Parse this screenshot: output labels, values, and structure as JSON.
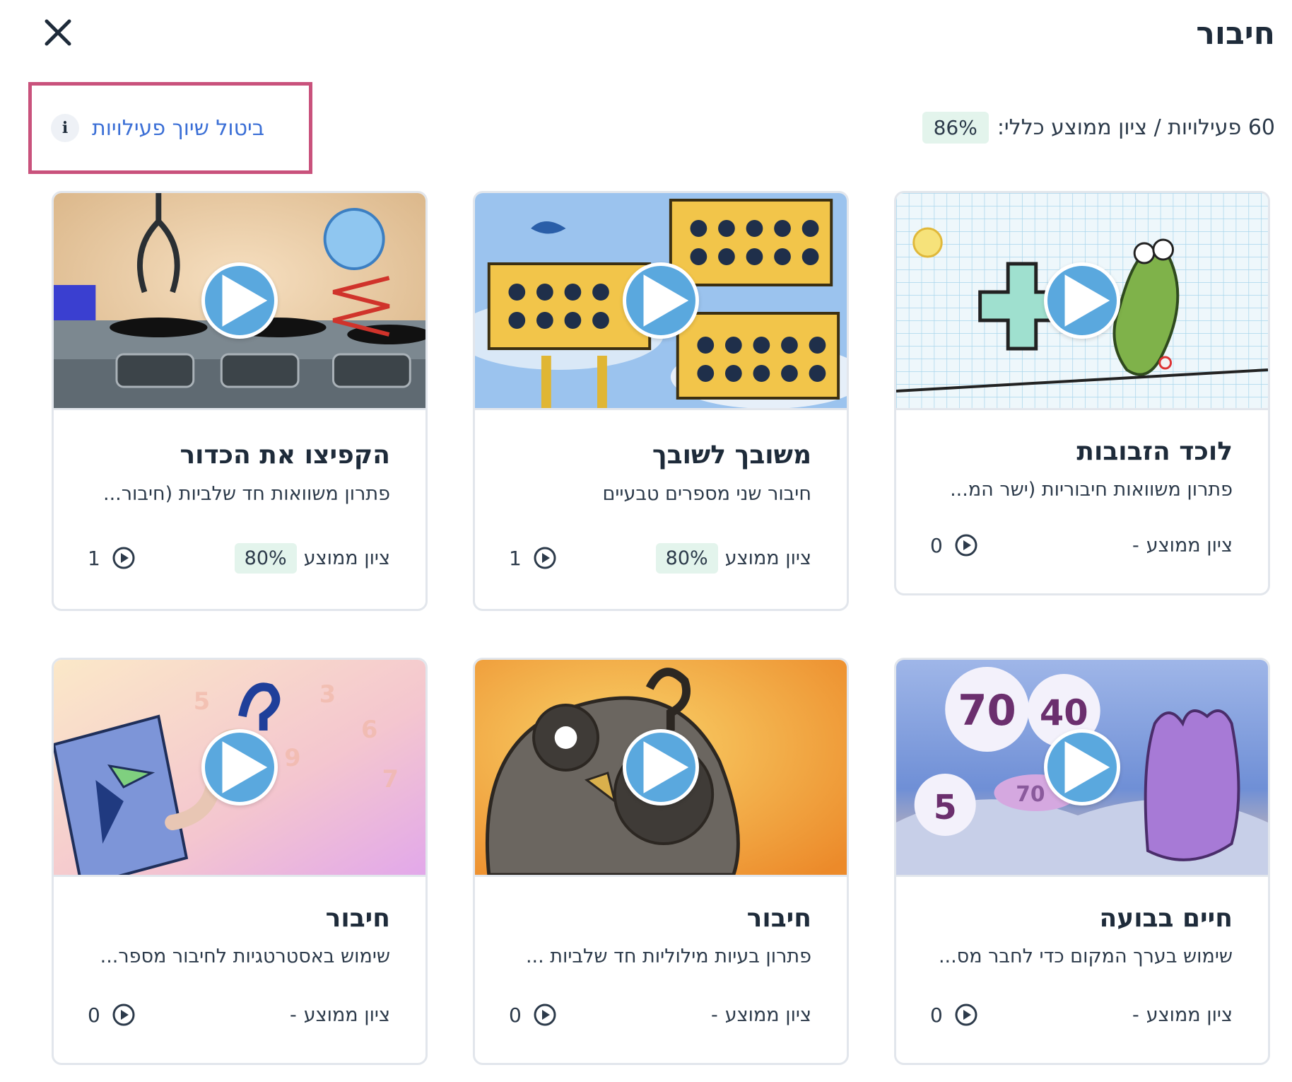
{
  "header": {
    "title": "חיבור",
    "close_icon": "close-icon"
  },
  "toolbar": {
    "unassign_label": "ביטול שיוך פעילויות",
    "info_icon_glyph": "i",
    "summary_text": "60 פעילויות / ציון ממוצע כללי:",
    "overall_average": "86%"
  },
  "cards": [
    {
      "title": "לוכד הזבובות",
      "description": "פתרון משוואות חיבוריות (ישר המ...",
      "avg_label": "ציון ממוצע",
      "avg_value": "-",
      "plays": "0",
      "image": "frog-number-line"
    },
    {
      "title": "משובך לשובך",
      "description": "חיבור שני מספרים טבעיים",
      "avg_label": "ציון ממוצע",
      "avg_value": "80%",
      "plays": "1",
      "image": "birdhouses"
    },
    {
      "title": "הקפיצו את הכדור",
      "description": "פתרון משוואות חד שלביות (חיבור...",
      "avg_label": "ציון ממוצע",
      "avg_value": "80%",
      "plays": "1",
      "image": "claw-bubble"
    },
    {
      "title": "חיים בבועה",
      "description": "שימוש בערך המקום כדי לחבר מס...",
      "avg_label": "ציון ממוצע",
      "avg_value": "-",
      "plays": "0",
      "image": "bubbles-numbers",
      "image_numbers": [
        "70",
        "40",
        "5",
        "70"
      ]
    },
    {
      "title": "חיבור",
      "description": "פתרון בעיות מילוליות חד שלביות ...",
      "avg_label": "ציון ממוצע",
      "avg_value": "-",
      "plays": "0",
      "image": "owl-question"
    },
    {
      "title": "חיבור",
      "description": "שימוש באסטרטגיות לחיבור מספר...",
      "avg_label": "ציון ממוצע",
      "avg_value": "-",
      "plays": "0",
      "image": "book-worm"
    }
  ],
  "colors": {
    "accent_link": "#3b6fd6",
    "highlight_border": "#c9527c",
    "badge_bg": "#e3f4ec",
    "play_button": "#5aa8de"
  }
}
